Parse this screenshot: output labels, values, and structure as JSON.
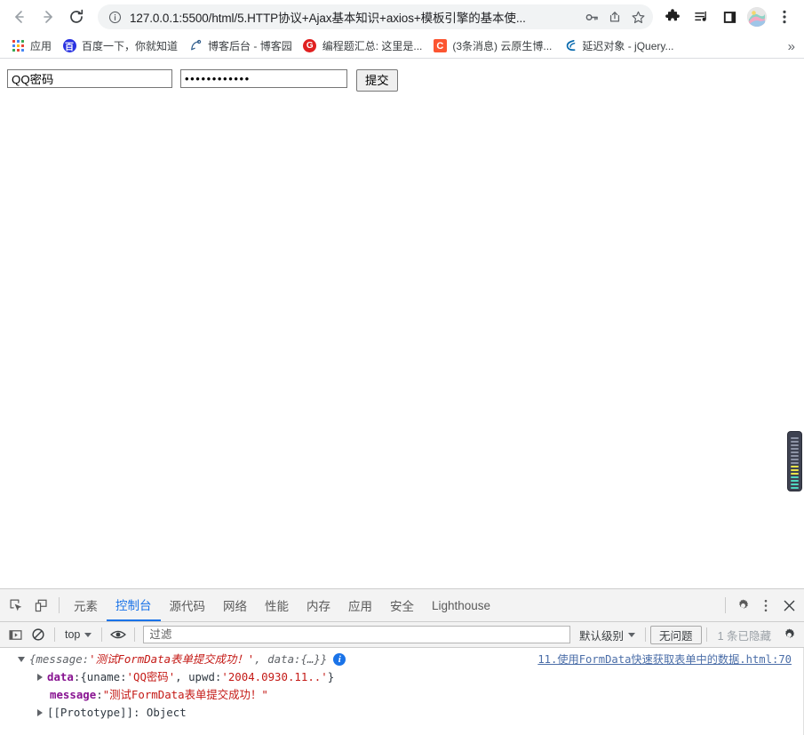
{
  "browser": {
    "nav": {
      "back_icon": "arrow-left-icon",
      "forward_icon": "arrow-right-icon",
      "reload_icon": "reload-icon"
    },
    "omnibox": {
      "info_icon": "page-info-icon",
      "url": "127.0.0.1:5500/html/5.HTTP协议+Ajax基本知识+axios+模板引擎的基本使...",
      "key_icon": "password-key-icon",
      "share_icon": "share-icon",
      "star_icon": "bookmark-star-icon"
    },
    "toolbar_icons": [
      {
        "name": "extensions-puzzle-icon"
      },
      {
        "name": "media-playlist-icon"
      },
      {
        "name": "side-panel-icon"
      },
      {
        "name": "profile-avatar"
      },
      {
        "name": "chrome-menu-icon"
      }
    ],
    "bookmarks": {
      "apps_label": "应用",
      "items": [
        {
          "label": "百度一下，你就知道",
          "icon": "baidu-favicon",
          "color": "#2932e1",
          "glyph": "百"
        },
        {
          "label": "博客后台 - 博客园",
          "icon": "cnblogs-favicon",
          "color": "#2e5b8a",
          "glyph": "C"
        },
        {
          "label": "编程题汇总: 这里是...",
          "icon": "g-favicon",
          "color": "#e02020",
          "glyph": "G"
        },
        {
          "label": "(3条消息) 云原生博...",
          "icon": "csdn-favicon",
          "color": "#fc5531",
          "glyph": "C"
        },
        {
          "label": "延迟对象 - jQuery...",
          "icon": "jquery-favicon",
          "color": "#0769ad",
          "glyph": "J"
        }
      ],
      "overflow_label": "»"
    }
  },
  "page": {
    "form": {
      "username_value": "QQ密码",
      "username_placeholder": "",
      "password_value": "••••••••••••",
      "password_placeholder": "",
      "submit_label": "提交"
    },
    "scrollbar": {
      "name": "page-scrollbar",
      "thumb_color": "#3e4251",
      "stripe_gray": "#8d93a5",
      "stripe_yellow": "#e8e34a",
      "stripe_teal": "#4fd6c0"
    }
  },
  "devtools": {
    "inspect_icon": "inspect-element-icon",
    "device_icon": "device-toolbar-icon",
    "tabs": [
      {
        "label": "元素",
        "active": false
      },
      {
        "label": "控制台",
        "active": true
      },
      {
        "label": "源代码",
        "active": false
      },
      {
        "label": "网络",
        "active": false
      },
      {
        "label": "性能",
        "active": false
      },
      {
        "label": "内存",
        "active": false
      },
      {
        "label": "应用",
        "active": false
      },
      {
        "label": "安全",
        "active": false
      },
      {
        "label": "Lighthouse",
        "active": false
      }
    ],
    "right_icons": [
      {
        "name": "settings-gear-icon"
      },
      {
        "name": "devtools-more-icon"
      },
      {
        "name": "devtools-close-icon"
      }
    ],
    "console_toolbar": {
      "sidebar_icon": "console-sidebar-icon",
      "clear_icon": "clear-console-icon",
      "context_label": "top",
      "eye_icon": "live-expression-icon",
      "filter_placeholder": "过滤",
      "filter_value": "",
      "level_label": "默认级别",
      "issues_label": "无问题",
      "hidden_label": "1 条已隐藏",
      "settings_icon": "console-settings-icon"
    },
    "console_log": {
      "line1_prefix": "{message: ",
      "line1_message": "'测试FormData表单提交成功！'",
      "line1_mid": ", data: ",
      "line1_suffix": "{…}}",
      "info_badge": "i",
      "source_link": "11.使用FormData快速获取表单中的数据.html:70",
      "line2_key": "data",
      "line2_colon": ": ",
      "line2_open": "{uname: ",
      "line2_uname": "'QQ密码'",
      "line2_mid": ", upwd: ",
      "line2_upwd": "'2004.0930.11..'",
      "line2_close": "}",
      "line3_key": "message",
      "line3_colon": ": ",
      "line3_value": "\"测试FormData表单提交成功！\"",
      "line4_text": "[[Prototype]]: Object"
    }
  }
}
